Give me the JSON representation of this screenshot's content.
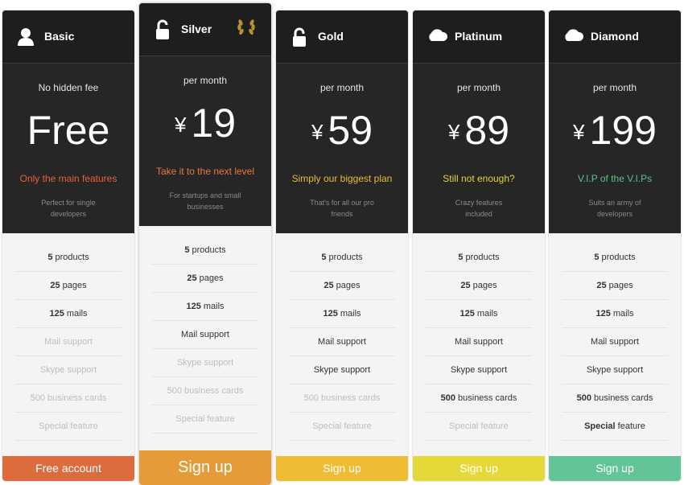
{
  "plans": [
    {
      "name": "Basic",
      "icon": "user-icon",
      "period": "No hidden fee",
      "currency": "",
      "price": "Free",
      "tagline": "Only the main features",
      "tagline_color": "#e6613a",
      "description_line1": "Perfect for single",
      "description_line2": "developers",
      "features": [
        {
          "bold": "5",
          "text": " products",
          "enabled": true
        },
        {
          "bold": "25",
          "text": " pages",
          "enabled": true
        },
        {
          "bold": "125",
          "text": " mails",
          "enabled": true
        },
        {
          "bold": "",
          "text": "Mail support",
          "enabled": false
        },
        {
          "bold": "",
          "text": "Skype support",
          "enabled": false
        },
        {
          "bold": "",
          "text": "500 business cards",
          "enabled": false
        },
        {
          "bold": "",
          "text": "Special feature",
          "enabled": false
        }
      ],
      "cta_label": "Free account",
      "cta_color": "#dc6c3d"
    },
    {
      "name": "Silver",
      "icon": "unlocked-padlock-icon",
      "badge_icon": "laurel-wreath-icon",
      "period": "per month",
      "currency": "¥",
      "price": "19",
      "tagline": "Take it to the next level",
      "tagline_color": "#e8783e",
      "description_line1": "For startups and small",
      "description_line2": "businesses",
      "features": [
        {
          "bold": "5",
          "text": " products",
          "enabled": true
        },
        {
          "bold": "25",
          "text": " pages",
          "enabled": true
        },
        {
          "bold": "125",
          "text": " mails",
          "enabled": true
        },
        {
          "bold": "",
          "text": "Mail support",
          "enabled": true
        },
        {
          "bold": "",
          "text": "Skype support",
          "enabled": false
        },
        {
          "bold": "",
          "text": "500 business cards",
          "enabled": false
        },
        {
          "bold": "",
          "text": "Special feature",
          "enabled": false
        }
      ],
      "cta_label": "Sign up",
      "cta_color": "#e49b38"
    },
    {
      "name": "Gold",
      "icon": "padlock-icon",
      "period": "per month",
      "currency": "¥",
      "price": "59",
      "tagline": "Simply our biggest plan",
      "tagline_color": "#efb936",
      "description_line1": "That's for all our pro",
      "description_line2": "friends",
      "features": [
        {
          "bold": "5",
          "text": " products",
          "enabled": true
        },
        {
          "bold": "25",
          "text": " pages",
          "enabled": true
        },
        {
          "bold": "125",
          "text": " mails",
          "enabled": true
        },
        {
          "bold": "",
          "text": "Mail support",
          "enabled": true
        },
        {
          "bold": "",
          "text": "Skype support",
          "enabled": true
        },
        {
          "bold": "",
          "text": "500 business cards",
          "enabled": false
        },
        {
          "bold": "",
          "text": "Special feature",
          "enabled": false
        }
      ],
      "cta_label": "Sign up",
      "cta_color": "#efbd34"
    },
    {
      "name": "Platinum",
      "icon": "cloud-icon",
      "period": "per month",
      "currency": "¥",
      "price": "89",
      "tagline": "Still not enough?",
      "tagline_color": "#e5d435",
      "description_line1": "Crazy features",
      "description_line2": "included",
      "features": [
        {
          "bold": "5",
          "text": " products",
          "enabled": true
        },
        {
          "bold": "25",
          "text": " pages",
          "enabled": true
        },
        {
          "bold": "125",
          "text": " mails",
          "enabled": true
        },
        {
          "bold": "",
          "text": "Mail support",
          "enabled": true
        },
        {
          "bold": "",
          "text": "Skype support",
          "enabled": true
        },
        {
          "bold": "500",
          "text": " business cards",
          "enabled": true
        },
        {
          "bold": "",
          "text": "Special feature",
          "enabled": false
        }
      ],
      "cta_label": "Sign up",
      "cta_color": "#e5d93a"
    },
    {
      "name": "Diamond",
      "icon": "cloud-icon",
      "period": "per month",
      "currency": "¥",
      "price": "199",
      "tagline": "V.I.P of the V.I.Ps",
      "tagline_color": "#5cc08c",
      "description_line1": "Suits an army of",
      "description_line2": "developers",
      "features": [
        {
          "bold": "5",
          "text": " products",
          "enabled": true
        },
        {
          "bold": "25",
          "text": " pages",
          "enabled": true
        },
        {
          "bold": "125",
          "text": " mails",
          "enabled": true
        },
        {
          "bold": "",
          "text": "Mail support",
          "enabled": true
        },
        {
          "bold": "",
          "text": "Skype support",
          "enabled": true
        },
        {
          "bold": "500",
          "text": " business cards",
          "enabled": true
        },
        {
          "bold": "Special",
          "text": " feature",
          "enabled": true
        }
      ],
      "cta_label": "Sign up",
      "cta_color": "#63c597"
    }
  ]
}
